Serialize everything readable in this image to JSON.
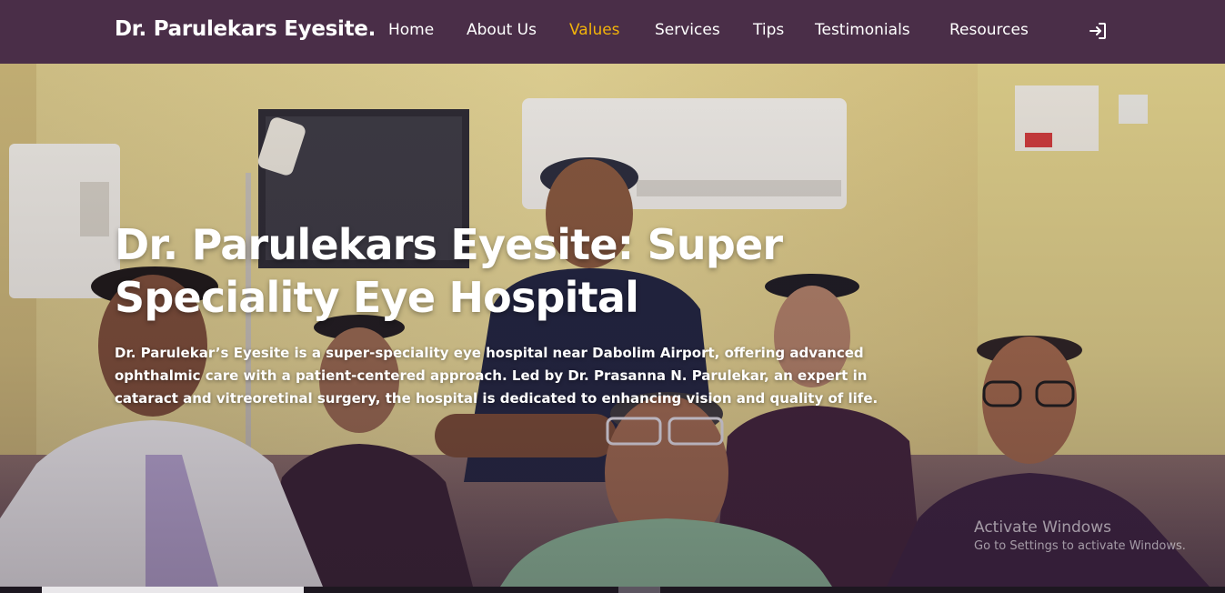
{
  "brand": "Dr. Parulekars Eyesite.",
  "nav": {
    "items": [
      {
        "label": "Home",
        "active": false
      },
      {
        "label": "About Us",
        "active": false
      },
      {
        "label": "Values",
        "active": true
      },
      {
        "label": "Services",
        "active": false
      },
      {
        "label": "Tips",
        "active": false
      },
      {
        "label": "Testimonials",
        "active": false
      },
      {
        "label": "Resources",
        "active": false
      }
    ],
    "login_icon": "login-icon"
  },
  "hero": {
    "title": "Dr. Parulekars Eyesite: Super Speciality Eye Hospital",
    "description": "Dr. Parulekar’s Eyesite is a super-speciality eye hospital near Dabolim Airport, offering advanced ophthalmic care with a patient-centered approach. Led by Dr. Prasanna N. Parulekar, an expert in cataract and vitreoretinal surgery, the hospital is dedicated to enhancing vision and quality of life."
  },
  "watermark": {
    "line1": "Activate Windows",
    "line2": "Go to Settings to activate Windows."
  },
  "colors": {
    "nav_bg": "#4a2e48",
    "active": "#f2b30a",
    "text": "#ffffff"
  }
}
